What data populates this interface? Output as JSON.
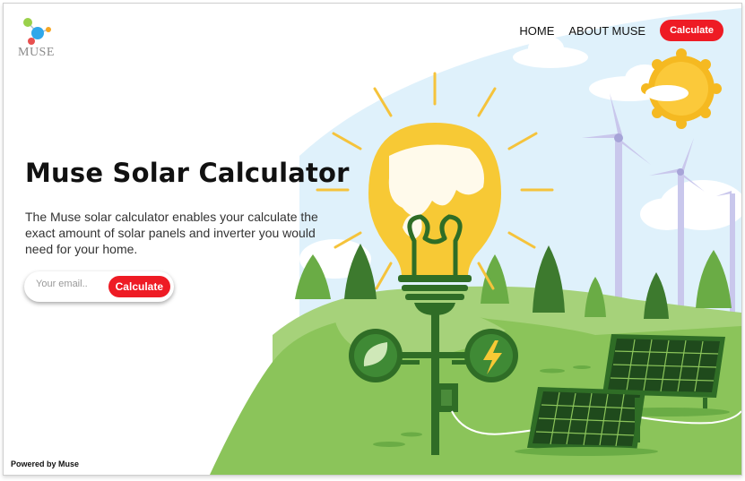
{
  "brand": {
    "logo_text": "MUSE",
    "logo_icon": "molecule-icon"
  },
  "nav": {
    "home": "HOME",
    "about": "ABOUT MUSE",
    "cta": "Calculate"
  },
  "hero": {
    "title": "Muse Solar Calculator",
    "description": "The Muse solar calculator enables your calculate the exact amount of solar panels and inverter you would need for your home.",
    "email_placeholder": "Your email..",
    "cta": "Calculate"
  },
  "footer": {
    "powered_by": "Powered by Muse"
  },
  "colors": {
    "accent": "#ee1b24",
    "grass": "#8bc45a",
    "sky": "#dff1fb",
    "sun": "#f5b921"
  }
}
